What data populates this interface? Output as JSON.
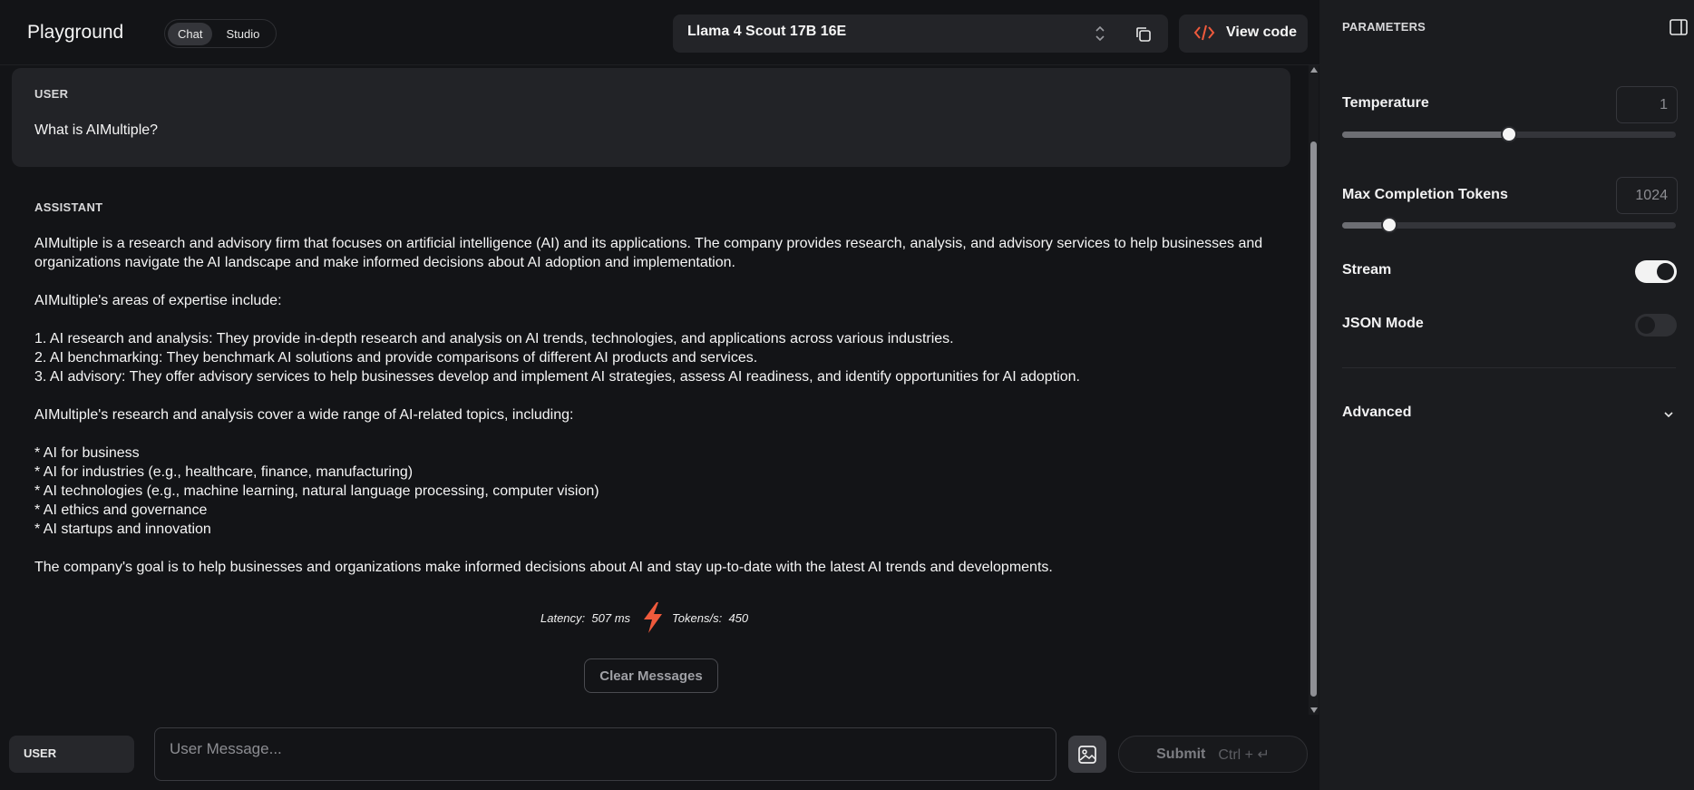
{
  "header": {
    "brand": "Playground",
    "modes": [
      {
        "label": "Chat",
        "active": true
      },
      {
        "label": "Studio",
        "active": false
      }
    ],
    "model_name": "Llama 4 Scout 17B 16E",
    "view_code_label": "View code",
    "accent_color": "#ef5a3c"
  },
  "conversation": {
    "user_role": "USER",
    "user_message": "What is AIMultiple?",
    "assistant_role": "ASSISTANT",
    "assistant_message": "AIMultiple is a research and advisory firm that focuses on artificial intelligence (AI) and its applications. The company provides research, analysis, and advisory services to help businesses and\norganizations navigate the AI landscape and make informed decisions about AI adoption and implementation.\n\nAIMultiple's areas of expertise include:\n\n1. AI research and analysis: They provide in-depth research and analysis on AI trends, technologies, and applications across various industries.\n2. AI benchmarking: They benchmark AI solutions and provide comparisons of different AI products and services.\n3. AI advisory: They offer advisory services to help businesses develop and implement AI strategies, assess AI readiness, and identify opportunities for AI adoption.\n\nAIMultiple's research and analysis cover a wide range of AI-related topics, including:\n\n* AI for business\n* AI for industries (e.g., healthcare, finance, manufacturing)\n* AI technologies (e.g., machine learning, natural language processing, computer vision)\n* AI ethics and governance\n* AI startups and innovation\n\nThe company's goal is to help businesses and organizations make informed decisions about AI and stay up-to-date with the latest AI trends and developments."
  },
  "stats": {
    "latency_label": "Latency:",
    "latency_value": "507 ms",
    "tokens_label": "Tokens/s:",
    "tokens_value": "450"
  },
  "clear_label": "Clear Messages",
  "composer": {
    "role": "USER",
    "placeholder": "User Message...",
    "submit_label": "Submit",
    "submit_shortcut": "Ctrl + ↵"
  },
  "parameters": {
    "title": "PARAMETERS",
    "temperature": {
      "label": "Temperature",
      "value": "1",
      "level": 0.5
    },
    "max_tokens": {
      "label": "Max Completion Tokens",
      "value": "1024",
      "level": 0.14
    },
    "stream": {
      "label": "Stream",
      "on": true
    },
    "json_mode": {
      "label": "JSON Mode",
      "on": false
    },
    "advanced_label": "Advanced"
  }
}
